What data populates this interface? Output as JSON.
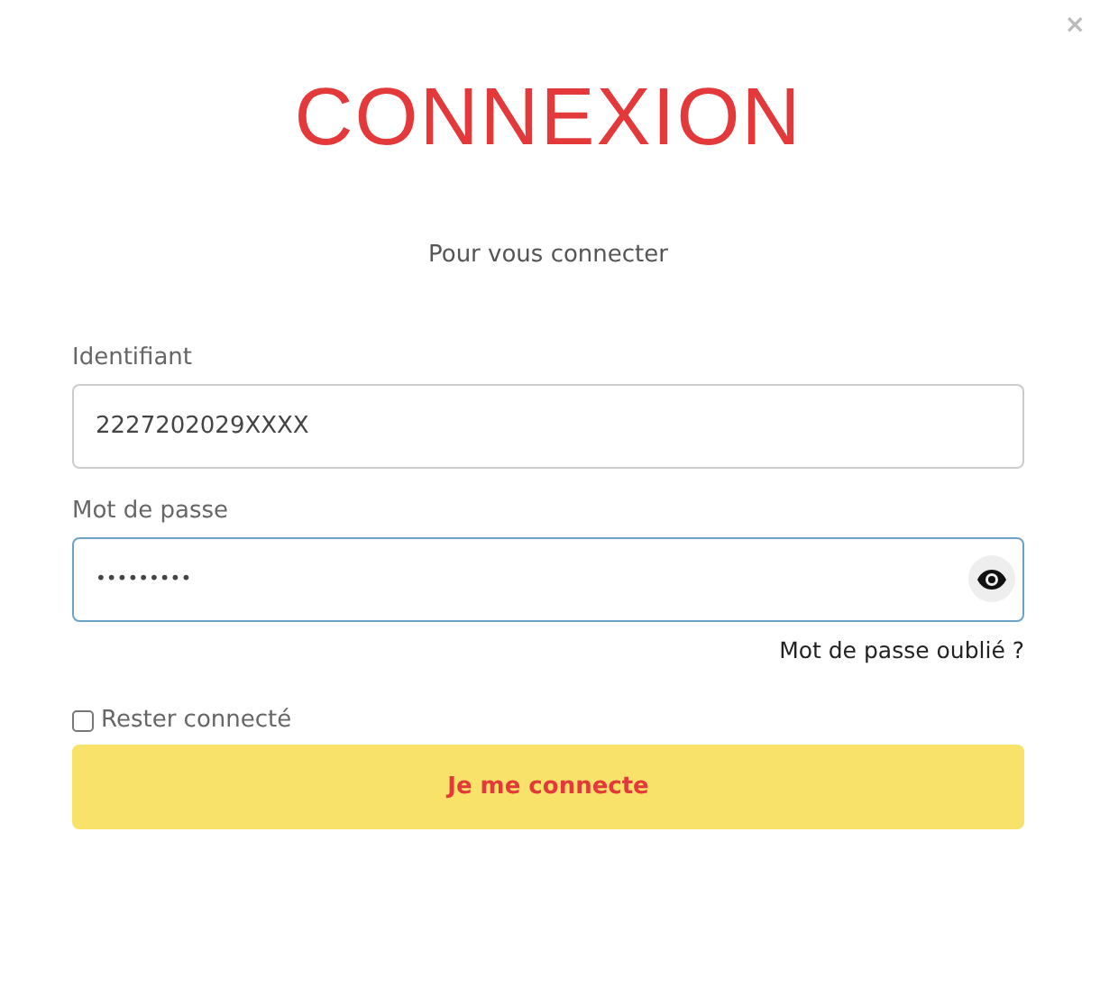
{
  "close": "×",
  "title": "CONNEXION",
  "subtitle": "Pour vous connecter",
  "fields": [
    {
      "label": "Identifiant",
      "value": "2227202029XXXX",
      "focused": false,
      "kind": "text"
    },
    {
      "label": "Mot de passe",
      "value": "•••••••••",
      "focused": true,
      "kind": "password"
    }
  ],
  "forgot_link": "Mot de passe oublié ?",
  "remember": {
    "label": "Rester connecté",
    "checked": false
  },
  "submit": "Je me connecte"
}
